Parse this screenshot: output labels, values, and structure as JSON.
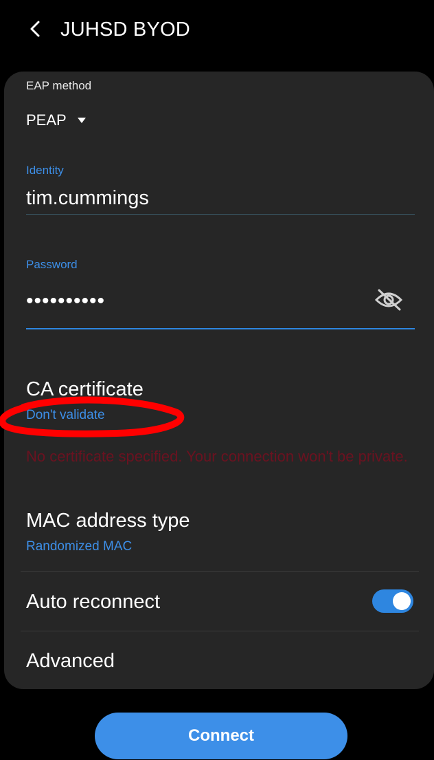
{
  "header": {
    "back_icon": "chevron-left-icon",
    "title": "JUHSD BYOD"
  },
  "eap": {
    "label": "EAP method",
    "value": "PEAP",
    "caret_icon": "caret-down-icon"
  },
  "identity": {
    "label": "Identity",
    "value": "tim.cummings"
  },
  "password": {
    "label": "Password",
    "value": "••••••••••",
    "visibility_icon": "eye-off-icon"
  },
  "ca_certificate": {
    "title": "CA certificate",
    "value": "Don't validate",
    "warning": "No certificate specified. Your connection won't be private."
  },
  "mac": {
    "title": "MAC address type",
    "value": "Randomized MAC"
  },
  "auto_reconnect": {
    "label": "Auto reconnect",
    "enabled": true
  },
  "advanced": {
    "label": "Advanced"
  },
  "connect": {
    "label": "Connect"
  },
  "colors": {
    "background": "#000000",
    "card": "#262626",
    "accent": "#3d8fe8",
    "warning": "#6b1220",
    "annotation": "#ff0000"
  }
}
